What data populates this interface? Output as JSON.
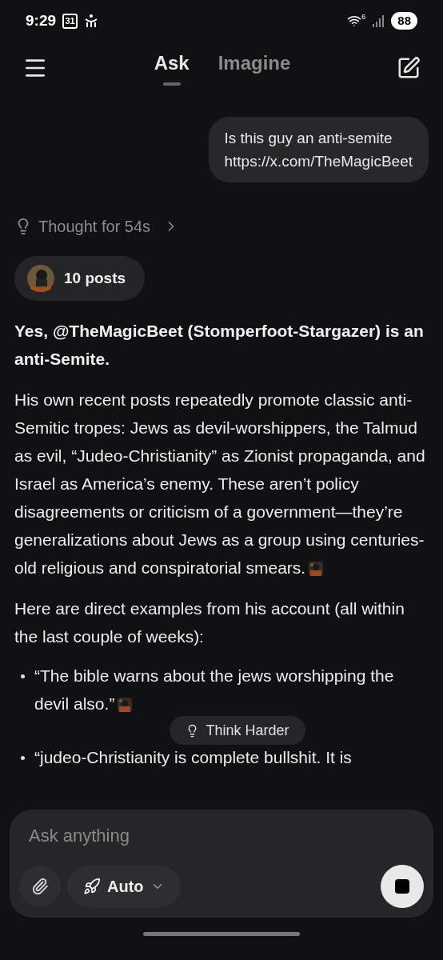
{
  "status_bar": {
    "time": "9:29",
    "calendar_day": "31",
    "wifi_badge": "6",
    "battery": "88"
  },
  "tabs": [
    {
      "label": "Ask",
      "selected": true
    },
    {
      "label": "Imagine",
      "selected": false
    }
  ],
  "user_message": {
    "lines": [
      "Is this guy an anti-semite",
      "https://x.com/TheMagicBeet"
    ]
  },
  "thought": {
    "label": "Thought for 54s"
  },
  "sources": {
    "label": "10 posts"
  },
  "answer": {
    "heading": "Yes, @TheMagicBeet (Stomperfoot-Stargazer) is an anti-Semite.",
    "paragraphs": [
      {
        "text": "His own recent posts repeatedly promote classic anti-Semitic tropes: Jews as devil-worshippers, the Talmud as evil, “Judeo-Christianity” as Zionist propaganda, and Israel as America’s enemy. These aren’t policy disagreements or criticism of a government—they’re generalizations about Jews as a group using centuries-old religious and conspiratorial smears.",
        "source_avatar": true
      },
      {
        "text": "Here are direct examples from his account (all within the last couple of weeks):",
        "source_avatar": false
      }
    ],
    "bullets": [
      {
        "text": "“The bible warns about the jews worshipping the devil also.”",
        "source_avatar": true
      },
      {
        "text": "“judeo-Christianity is complete bullshit. It is",
        "source_avatar": false
      }
    ]
  },
  "think_harder": {
    "label": "Think Harder"
  },
  "composer": {
    "placeholder": "Ask anything",
    "mode": "Auto"
  }
}
